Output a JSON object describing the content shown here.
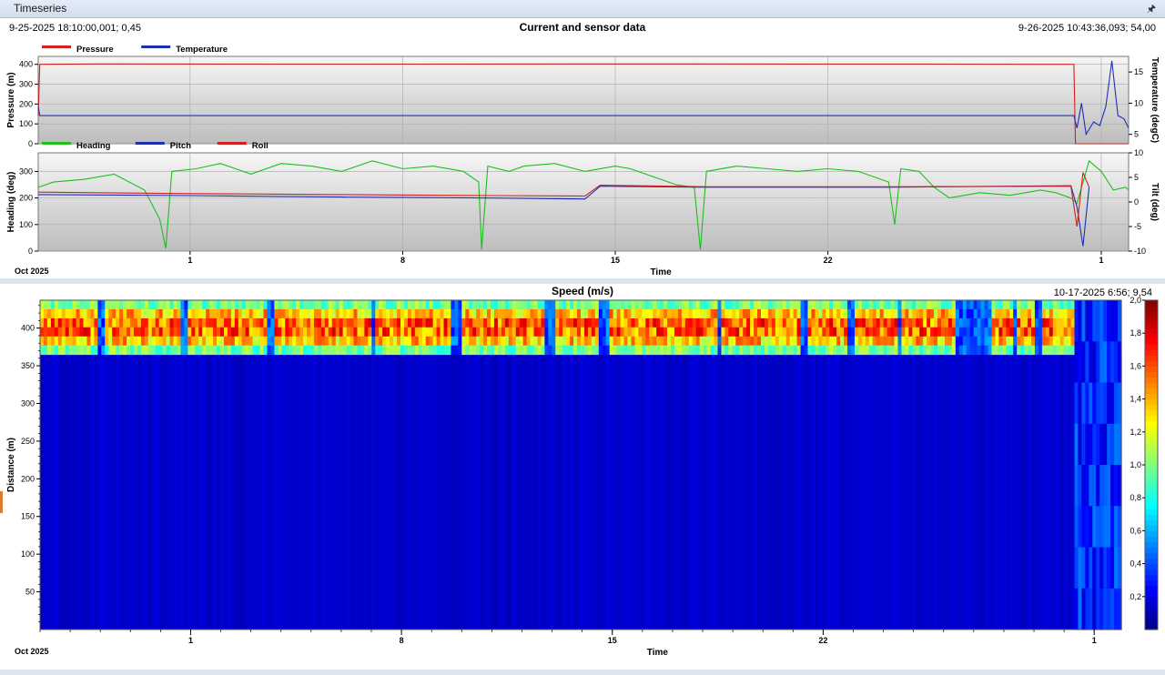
{
  "window": {
    "title": "Timeseries",
    "pin_icon": "pin-icon"
  },
  "top_panel": {
    "title": "Current and sensor data",
    "cursor_left": "9-25-2025 18:10:00,001; 0,45",
    "cursor_right": "9-26-2025 10:43:36,093; 54,00"
  },
  "bottom_panel": {
    "title": "Speed (m/s)",
    "cursor_right": "10-17-2025 6:56; 9,54"
  },
  "time_axis": {
    "start_label": "Oct 2025",
    "xlabel": "Time",
    "ticks": [
      "1",
      "8",
      "15",
      "22",
      "1"
    ]
  },
  "chart_data": [
    {
      "type": "line",
      "panel": "pressure-temperature",
      "ylabel": "Pressure (m)",
      "y2label": "Temperature (degC)",
      "ylim": [
        0,
        440
      ],
      "y2lim": [
        3.5,
        17.5
      ],
      "yticks": [
        0,
        100,
        200,
        300,
        400
      ],
      "y2ticks": [
        5,
        10,
        15
      ],
      "legend": "top-left",
      "grid": true,
      "x_range_days": [
        0,
        35.9
      ],
      "series": [
        {
          "name": "Pressure",
          "axis": "left",
          "color": "#d21f1f",
          "points": [
            [
              0,
              140
            ],
            [
              0.05,
              400
            ],
            [
              2,
              402
            ],
            [
              10,
              401
            ],
            [
              20,
              402
            ],
            [
              30,
              401
            ],
            [
              34.1,
              400
            ],
            [
              34.15,
              0
            ],
            [
              35.9,
              0
            ]
          ]
        },
        {
          "name": "Temperature",
          "axis": "right",
          "color": "#1f2fb4",
          "points": [
            [
              0,
              9.5
            ],
            [
              0.05,
              8
            ],
            [
              15,
              8
            ],
            [
              30,
              8
            ],
            [
              34.1,
              8
            ],
            [
              34.2,
              6
            ],
            [
              34.35,
              10
            ],
            [
              34.5,
              5
            ],
            [
              34.75,
              7
            ],
            [
              34.95,
              6.4
            ],
            [
              35.15,
              9.5
            ],
            [
              35.35,
              16.8
            ],
            [
              35.55,
              8
            ],
            [
              35.75,
              7.5
            ],
            [
              35.9,
              6
            ]
          ]
        }
      ]
    },
    {
      "type": "line",
      "panel": "heading-pitch-roll",
      "ylabel": "Heading (deg)",
      "y2label": "Tilt (deg)",
      "ylim": [
        0,
        370
      ],
      "y2lim": [
        -10,
        10
      ],
      "yticks": [
        0,
        100,
        200,
        300
      ],
      "y2ticks": [
        -10,
        -5,
        0,
        5,
        10
      ],
      "legend": "top-left",
      "grid": true,
      "x_range_days": [
        0,
        35.9
      ],
      "series": [
        {
          "name": "Heading",
          "axis": "left",
          "color": "#1dbf1d",
          "points": [
            [
              0,
              240
            ],
            [
              0.5,
              260
            ],
            [
              1.5,
              270
            ],
            [
              2.5,
              290
            ],
            [
              3.5,
              230
            ],
            [
              4.0,
              120
            ],
            [
              4.2,
              10
            ],
            [
              4.4,
              300
            ],
            [
              5.2,
              310
            ],
            [
              6,
              330
            ],
            [
              7,
              290
            ],
            [
              8,
              330
            ],
            [
              9,
              320
            ],
            [
              10,
              300
            ],
            [
              11,
              340
            ],
            [
              12,
              310
            ],
            [
              13,
              320
            ],
            [
              14,
              300
            ],
            [
              14.5,
              260
            ],
            [
              14.6,
              5
            ],
            [
              14.8,
              320
            ],
            [
              15.5,
              300
            ],
            [
              16,
              320
            ],
            [
              17,
              330
            ],
            [
              18,
              300
            ],
            [
              19,
              320
            ],
            [
              19.5,
              310
            ],
            [
              20,
              290
            ],
            [
              21,
              250
            ],
            [
              21.6,
              240
            ],
            [
              21.8,
              5
            ],
            [
              22.0,
              300
            ],
            [
              23,
              320
            ],
            [
              24,
              310
            ],
            [
              25,
              300
            ],
            [
              26,
              310
            ],
            [
              27,
              300
            ],
            [
              28,
              260
            ],
            [
              28.2,
              100
            ],
            [
              28.4,
              310
            ],
            [
              29,
              300
            ],
            [
              29.5,
              240
            ],
            [
              30,
              200
            ],
            [
              31,
              220
            ],
            [
              32,
              210
            ],
            [
              33,
              230
            ],
            [
              33.5,
              220
            ],
            [
              34,
              200
            ],
            [
              34.2,
              180
            ],
            [
              34.6,
              340
            ],
            [
              35,
              300
            ],
            [
              35.4,
              230
            ],
            [
              35.8,
              240
            ],
            [
              35.9,
              230
            ]
          ]
        },
        {
          "name": "Pitch",
          "axis": "right",
          "color": "#1f2fb4",
          "points": [
            [
              0,
              1.5
            ],
            [
              5,
              1.3
            ],
            [
              10,
              1
            ],
            [
              15,
              0.8
            ],
            [
              18,
              0.6
            ],
            [
              18.5,
              3.2
            ],
            [
              22,
              3
            ],
            [
              28,
              3
            ],
            [
              34,
              3.3
            ],
            [
              34.2,
              -1
            ],
            [
              34.4,
              -9
            ],
            [
              34.6,
              3
            ]
          ]
        },
        {
          "name": "Roll",
          "axis": "right",
          "color": "#d21f1f",
          "points": [
            [
              0,
              2
            ],
            [
              5,
              1.7
            ],
            [
              10,
              1.5
            ],
            [
              15,
              1.3
            ],
            [
              18,
              1.2
            ],
            [
              18.5,
              3.4
            ],
            [
              22,
              3.1
            ],
            [
              28,
              3.1
            ],
            [
              34,
              3.2
            ],
            [
              34.2,
              -5
            ],
            [
              34.4,
              6
            ],
            [
              34.6,
              3
            ]
          ]
        }
      ]
    },
    {
      "type": "heatmap",
      "panel": "speed",
      "title": "Speed (m/s)",
      "ylabel": "Distance (m)",
      "xlabel": "Time",
      "ylim": [
        0,
        437
      ],
      "yticks": [
        50,
        100,
        150,
        200,
        250,
        300,
        350,
        400
      ],
      "colorbar": {
        "range": [
          0,
          2.0
        ],
        "ticks": [
          "0,2",
          "0,4",
          "0,6",
          "0,8",
          "1,0",
          "1,2",
          "1,4",
          "1,6",
          "1,8",
          "2,0"
        ],
        "colormap": "jet"
      },
      "structure": {
        "background_speed": 0.15,
        "near_surface_band_m": [
          365,
          437
        ],
        "band_core_speed": 1.7,
        "end_day": 34.3,
        "data_gaps_days": [
          [
            1.8,
            2.1
          ],
          [
            4.6,
            4.8
          ],
          [
            7.5,
            7.7
          ],
          [
            10.9,
            11.1
          ],
          [
            13.6,
            13.9
          ],
          [
            16.7,
            17.0
          ],
          [
            18.5,
            18.8
          ],
          [
            22.4,
            22.6
          ],
          [
            25.2,
            25.4
          ],
          [
            26.8,
            27.0
          ],
          [
            28.4,
            28.6
          ],
          [
            30.3,
            31.5
          ],
          [
            32.2,
            32.4
          ],
          [
            33.0,
            33.2
          ]
        ]
      }
    }
  ]
}
